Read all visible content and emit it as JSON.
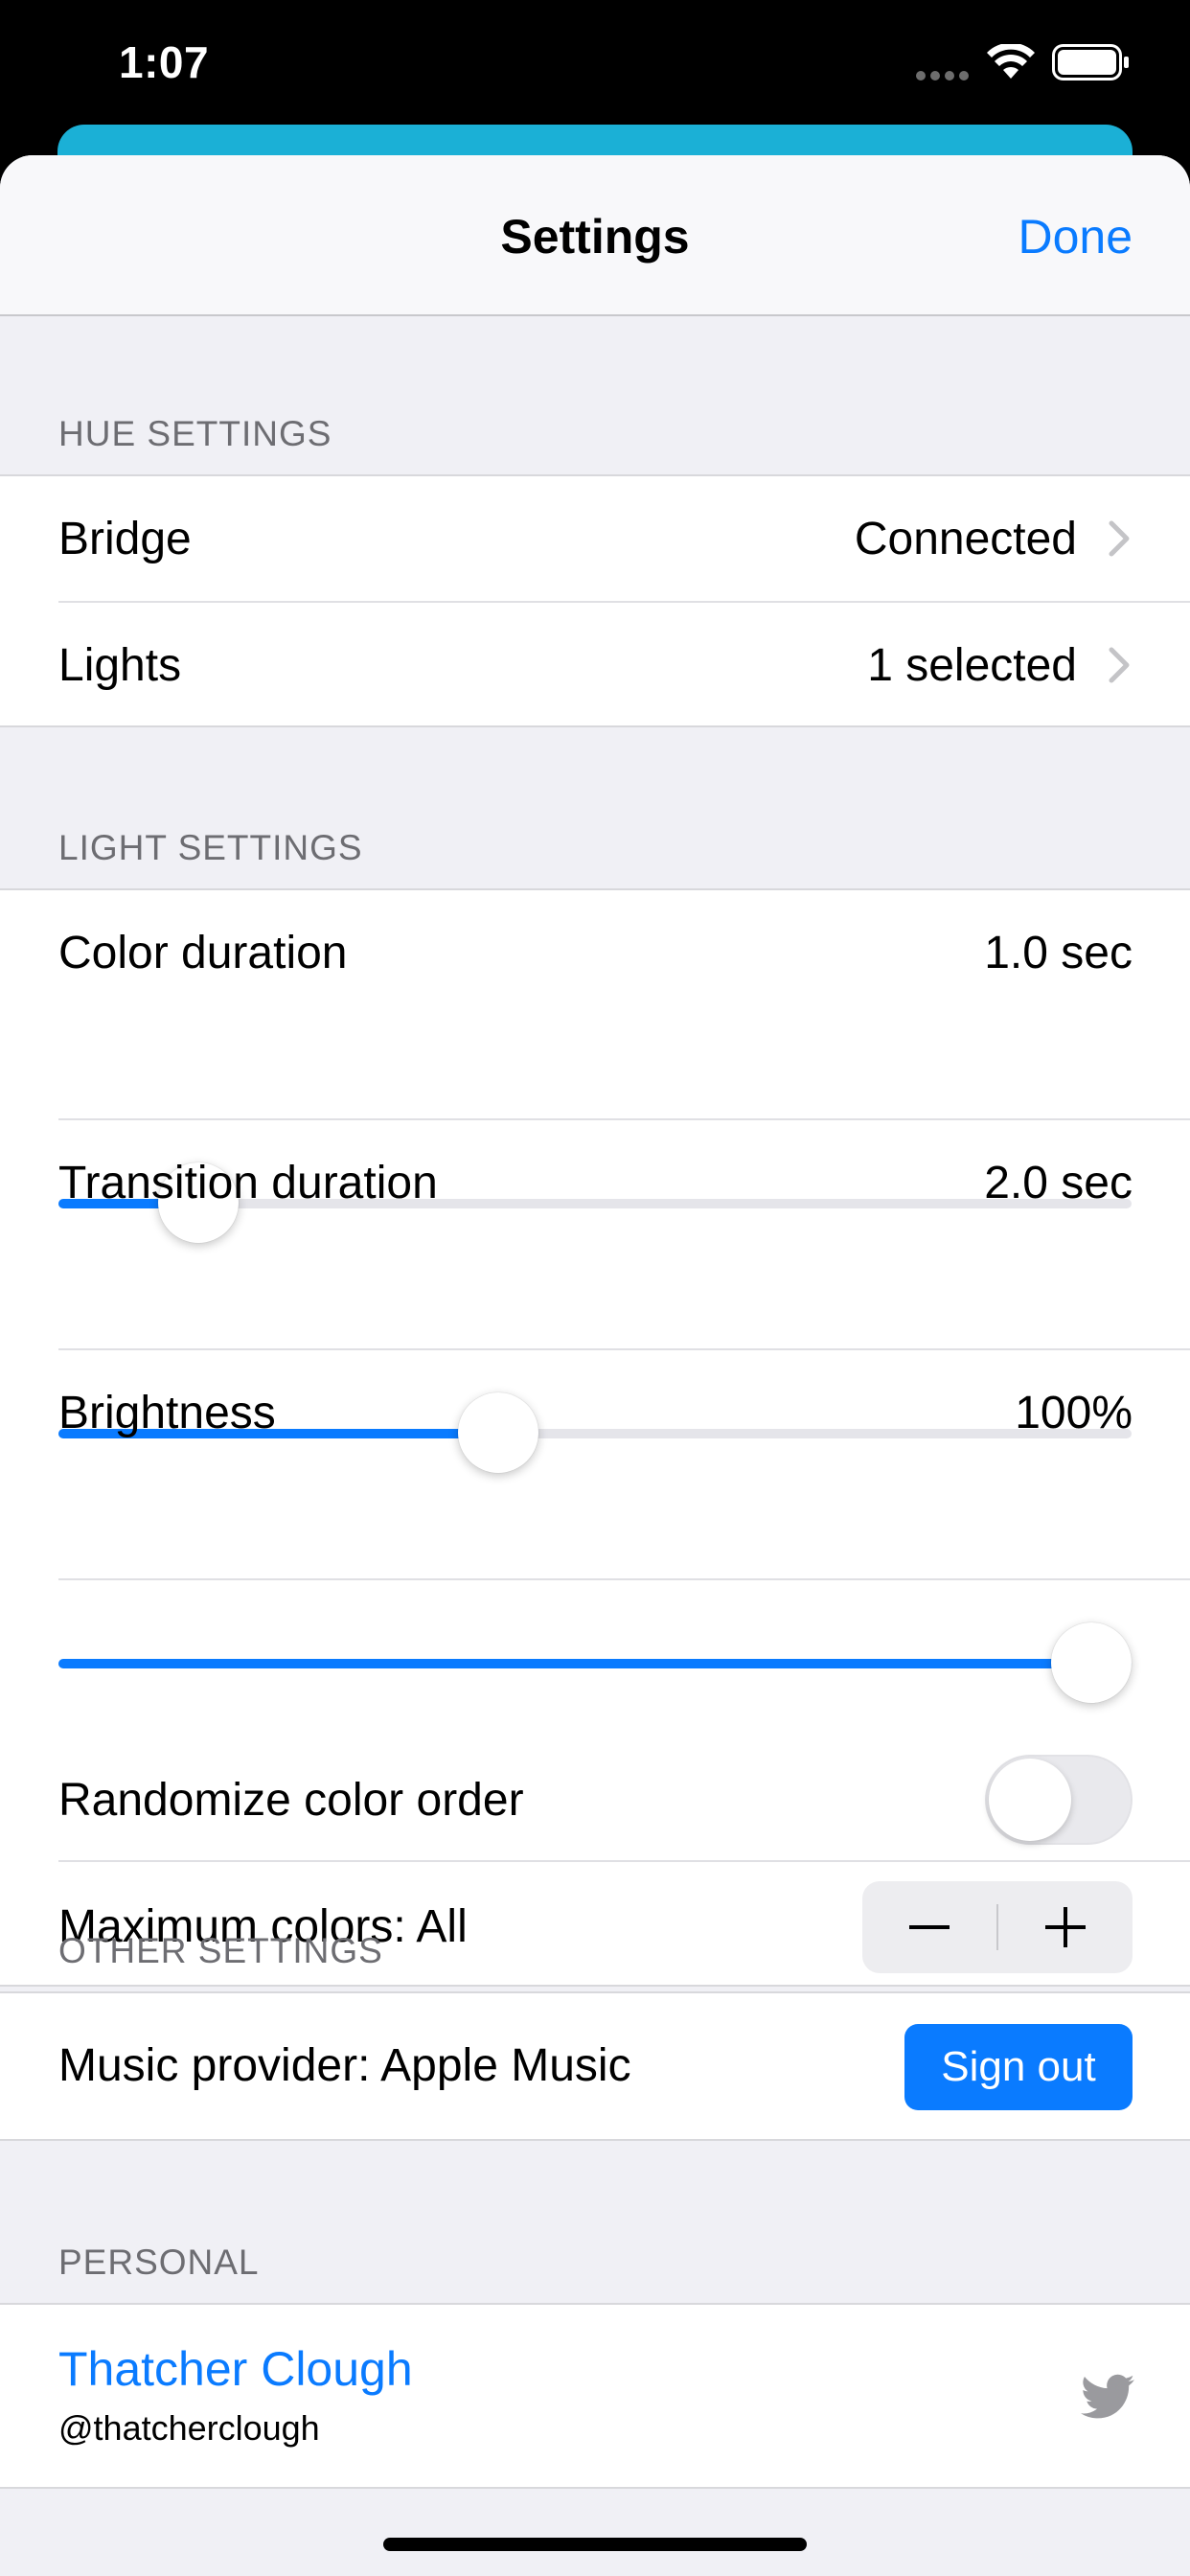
{
  "status_bar": {
    "time": "1:07",
    "icons": [
      "signal-icon",
      "wifi-icon",
      "battery-icon"
    ]
  },
  "nav": {
    "title": "Settings",
    "done_label": "Done"
  },
  "hue_settings": {
    "header": "HUE SETTINGS",
    "rows": [
      {
        "label": "Bridge",
        "value": "Connected",
        "icon": "chevron-right-icon"
      },
      {
        "label": "Lights",
        "value": "1 selected",
        "icon": "chevron-right-icon"
      }
    ]
  },
  "light_settings": {
    "header": "LIGHT SETTINGS",
    "sliders": [
      {
        "label": "Color duration",
        "value": "1.0 sec",
        "fraction": 0.13
      },
      {
        "label": "Transition duration",
        "value": "2.0 sec",
        "fraction": 0.41
      },
      {
        "label": "Brightness",
        "value": "100%",
        "fraction": 1.0
      }
    ],
    "randomize": {
      "label": "Randomize color order",
      "on": false
    },
    "max_colors": {
      "label": "Maximum colors: All",
      "icons": [
        "minus-icon",
        "plus-icon"
      ]
    }
  },
  "other_settings": {
    "header": "OTHER SETTINGS",
    "music_label": "Music provider: Apple Music",
    "signout_label": "Sign out"
  },
  "personal": {
    "header": "PERSONAL",
    "name": "Thatcher Clough",
    "handle": "@thatcherclough",
    "icon": "twitter-icon"
  },
  "colors": {
    "accent": "#0a7bff",
    "background": "#f0f0f5",
    "underlying_card": "#1bb0d6"
  }
}
